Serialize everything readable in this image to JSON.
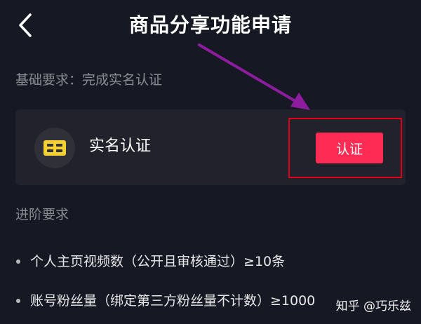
{
  "header": {
    "title": "商品分享功能申请",
    "back_icon": "chevron-left-icon"
  },
  "basic_requirement": {
    "label": "基础要求：完成实名认证"
  },
  "verify_card": {
    "icon": "id-card-icon",
    "title": "实名认证",
    "button_label": "认证",
    "button_color": "#fe2c55",
    "icon_color": "#f7d131"
  },
  "advanced_requirement": {
    "label": "进阶要求",
    "items": [
      "个人主页视频数（公开且审核通过）≥10条",
      "账号粉丝量（绑定第三方粉丝量不计数）≥1000"
    ]
  },
  "annotations": {
    "arrow_color": "#8e1c9e",
    "highlight_color": "#e0001a"
  },
  "watermark": {
    "text": "知乎 @巧乐兹"
  },
  "colors": {
    "background": "#161823",
    "card": "#21222b",
    "muted_text": "#8a8b91"
  }
}
